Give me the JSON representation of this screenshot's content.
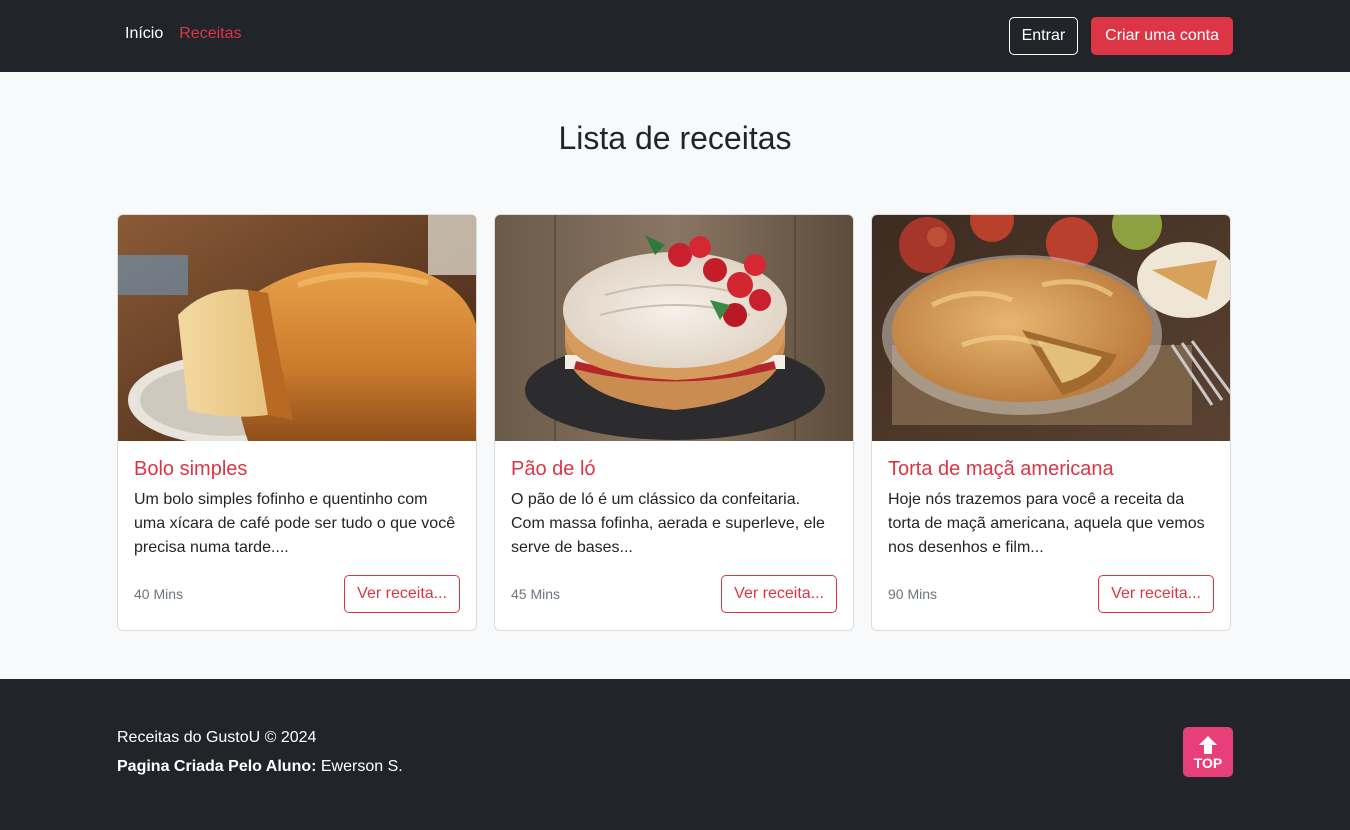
{
  "navbar": {
    "links": [
      {
        "label": "Início"
      },
      {
        "label": "Receitas"
      }
    ],
    "login_label": "Entrar",
    "signup_label": "Criar uma conta"
  },
  "main": {
    "title": "Lista de receitas",
    "cards": [
      {
        "title": "Bolo simples",
        "description": "Um bolo simples fofinho e quentinho com uma xícara de café pode ser tudo o que você precisa numa tarde....",
        "time": "40 Mins",
        "button_label": "Ver receita..."
      },
      {
        "title": "Pão de ló",
        "description": "O pão de ló é um clássico da confeitaria. Com massa fofinha, aerada e superleve, ele serve de bases...",
        "time": "45 Mins",
        "button_label": "Ver receita..."
      },
      {
        "title": "Torta de maçã americana",
        "description": "Hoje nós trazemos para você a receita da torta de maçã americana, aquela que vemos nos desenhos e film...",
        "time": "90 Mins",
        "button_label": "Ver receita..."
      }
    ]
  },
  "footer": {
    "copyright": "Receitas do GustoU © 2024",
    "author_label": "Pagina Criada Pelo Aluno:",
    "author_name": " Ewerson S.",
    "top_label": "TOP"
  },
  "colors": {
    "navbar_bg": "#212529",
    "accent": "#dc3545",
    "page_bg": "#f8f9fa",
    "top_button": "#e63f7a"
  },
  "icons": {
    "top_button": "arrow-up-icon"
  }
}
